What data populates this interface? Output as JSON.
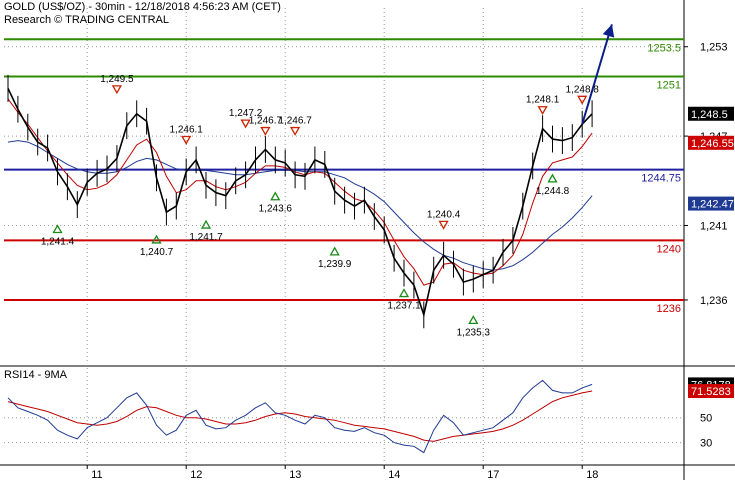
{
  "header": {
    "line1": "GOLD (US$/OZ) - 30min - 12/18/2018 4:56:23 AM (CET)",
    "line2": "Research © TRADING CENTRAL"
  },
  "colors": {
    "price": "#000000",
    "ma_fast": "#c00000",
    "ma_slow": "#1f3a93",
    "support": "#cc0000",
    "pivot": "#1f1fa0",
    "resistance": "#2e8b00",
    "arrow": "#0b1f8a",
    "grid": "#999999",
    "marker_up": "#1a8a1a",
    "marker_down": "#cc2200",
    "tag_price_bg": "#000000",
    "tag_red_bg": "#cc0000",
    "tag_blue_bg": "#1f3a93"
  },
  "chart_data": [
    {
      "type": "line",
      "title": "GOLD (US$/OZ) - 30min - 12/18/2018 4:56:23 AM (CET)",
      "ylim": [
        1231.7,
        1255.6
      ],
      "y_ticks": [
        "1,253",
        "1,247",
        "1,241",
        "1,236"
      ],
      "y_tick_values": [
        1253,
        1247,
        1241,
        1236
      ],
      "x_tick_labels": [
        "11",
        "12",
        "13",
        "14",
        "17",
        "18"
      ],
      "x_tick_index": [
        8,
        18,
        28,
        38,
        48,
        58
      ],
      "series": [
        {
          "values": [
            1250.2,
            1248.8,
            1247.6,
            1246.6,
            1246.2,
            1244.6,
            1243.6,
            1242.4,
            1243.9,
            1244.5,
            1244.8,
            1245.5,
            1247.7,
            1248.5,
            1248.0,
            1244.2,
            1241.9,
            1242.3,
            1244.6,
            1245.4,
            1243.7,
            1243.2,
            1243.0,
            1244.0,
            1244.4,
            1245.4,
            1246.1,
            1245.4,
            1245.2,
            1244.4,
            1244.3,
            1245.4,
            1245.1,
            1243.3,
            1242.7,
            1242.3,
            1242.7,
            1241.6,
            1240.7,
            1238.8,
            1237.8,
            1237.0,
            1235.0,
            1238.0,
            1239.0,
            1238.4,
            1237.2,
            1237.4,
            1237.7,
            1238.0,
            1239.2,
            1240.0,
            1242.3,
            1245.0,
            1247.5,
            1246.8,
            1246.7,
            1246.9,
            1247.8,
            1248.5
          ]
        },
        {
          "name": "",
          "values": [
            1249.5,
            1248.6,
            1247.8,
            1246.9,
            1246.0,
            1245.2,
            1244.4,
            1243.7,
            1243.4,
            1243.5,
            1243.8,
            1244.4,
            1245.4,
            1246.4,
            1246.8,
            1245.9,
            1244.3,
            1243.2,
            1243.4,
            1244.0,
            1244.0,
            1243.6,
            1243.4,
            1243.6,
            1243.9,
            1244.5,
            1245.0,
            1245.0,
            1244.9,
            1244.6,
            1244.4,
            1244.6,
            1244.5,
            1243.9,
            1243.3,
            1242.8,
            1242.6,
            1242.0,
            1241.2,
            1240.0,
            1238.9,
            1238.1,
            1237.0,
            1237.2,
            1238.4,
            1238.5,
            1238.0,
            1237.8,
            1237.7,
            1237.8,
            1238.3,
            1239.0,
            1240.4,
            1242.5,
            1244.3,
            1245.2,
            1245.4,
            1245.6,
            1246.3,
            1247.2
          ]
        },
        {
          "name": "",
          "values": [
            1246.6,
            1246.7,
            1246.6,
            1246.3,
            1245.9,
            1245.5,
            1245.1,
            1244.8,
            1244.6,
            1244.5,
            1244.5,
            1244.6,
            1244.9,
            1245.3,
            1245.5,
            1245.4,
            1245.1,
            1244.8,
            1244.7,
            1244.7,
            1244.7,
            1244.6,
            1244.5,
            1244.4,
            1244.4,
            1244.5,
            1244.6,
            1244.7,
            1244.7,
            1244.7,
            1244.6,
            1244.6,
            1244.6,
            1244.4,
            1244.2,
            1243.8,
            1243.5,
            1243.1,
            1242.6,
            1241.9,
            1241.2,
            1240.5,
            1239.9,
            1239.4,
            1239.0,
            1238.8,
            1238.5,
            1238.3,
            1238.1,
            1238.0,
            1238.1,
            1238.3,
            1238.7,
            1239.2,
            1239.8,
            1240.4,
            1240.9,
            1241.5,
            1242.2,
            1243.0
          ]
        }
      ],
      "levels": [
        {
          "value": 1253.5,
          "label": "1253.5",
          "role": "resistance"
        },
        {
          "value": 1251.0,
          "label": "1251",
          "role": "resistance"
        },
        {
          "value": 1244.75,
          "label": "1244.75",
          "role": "pivot"
        },
        {
          "value": 1240.0,
          "label": "1240",
          "role": "support"
        },
        {
          "value": 1236.0,
          "label": "1236",
          "role": "support"
        }
      ],
      "annotations": [
        {
          "label": "1,249.5",
          "i": 11,
          "value": 1249.5,
          "kind": "high"
        },
        {
          "label": "1,246.1",
          "i": 18,
          "value": 1246.1,
          "kind": "high"
        },
        {
          "label": "1,247.2",
          "i": 24,
          "value": 1247.2,
          "kind": "high"
        },
        {
          "label": "1,246.7",
          "i": 26,
          "value": 1246.7,
          "kind": "high"
        },
        {
          "label": "1,246.7",
          "i": 29,
          "value": 1246.7,
          "kind": "high"
        },
        {
          "label": "1,240.4",
          "i": 44,
          "value": 1240.4,
          "kind": "high"
        },
        {
          "label": "1,248.1",
          "i": 54,
          "value": 1248.1,
          "kind": "high"
        },
        {
          "label": "1,248.8",
          "i": 58,
          "value": 1248.8,
          "kind": "high"
        },
        {
          "label": "1,241.4",
          "i": 5,
          "value": 1241.4,
          "kind": "low"
        },
        {
          "label": "1,240.7",
          "i": 15,
          "value": 1240.7,
          "kind": "low"
        },
        {
          "label": "1,241.7",
          "i": 20,
          "value": 1241.7,
          "kind": "low"
        },
        {
          "label": "1,243.6",
          "i": 27,
          "value": 1243.6,
          "kind": "low"
        },
        {
          "label": "1,239.9",
          "i": 33,
          "value": 1239.9,
          "kind": "low"
        },
        {
          "label": "1,237.1",
          "i": 40,
          "value": 1237.1,
          "kind": "low"
        },
        {
          "label": "1,235.3",
          "i": 47,
          "value": 1235.3,
          "kind": "low"
        },
        {
          "label": "1,244.8",
          "i": 55,
          "value": 1244.8,
          "kind": "low"
        }
      ],
      "tags": [
        {
          "label": "1,248.5",
          "value": 1248.5,
          "kind": "price"
        },
        {
          "label": "1,246.55",
          "value": 1246.55,
          "kind": "red"
        },
        {
          "label": "1,242.47",
          "value": 1242.47,
          "kind": "blue"
        }
      ],
      "forecast_arrow": {
        "from": [
          58,
          1247.8
        ],
        "to": [
          61,
          1254.5
        ]
      }
    },
    {
      "type": "line",
      "title": "RSI14 - 9MA",
      "ylim": [
        12,
        90
      ],
      "y_ticks": [
        "50",
        "30"
      ],
      "y_tick_values": [
        50,
        30
      ],
      "series": [
        {
          "values": [
            66,
            58,
            55,
            52,
            48,
            40,
            36,
            33,
            42,
            46,
            50,
            58,
            66,
            70,
            60,
            44,
            36,
            40,
            52,
            56,
            44,
            41,
            42,
            48,
            52,
            58,
            62,
            54,
            52,
            48,
            45,
            52,
            50,
            42,
            40,
            39,
            42,
            38,
            36,
            30,
            28,
            27,
            22,
            40,
            52,
            46,
            36,
            38,
            40,
            42,
            48,
            54,
            66,
            74,
            80,
            72,
            70,
            70,
            74,
            76.8
          ]
        },
        {
          "values": [
            63,
            61,
            59,
            57,
            55,
            52,
            49,
            46,
            45,
            44,
            45,
            47,
            51,
            56,
            59,
            58,
            55,
            52,
            50,
            50,
            49,
            47,
            45,
            45,
            46,
            48,
            51,
            53,
            54,
            53,
            51,
            50,
            49,
            48,
            46,
            44,
            43,
            42,
            41,
            39,
            37,
            35,
            32,
            31,
            33,
            35,
            36,
            37,
            38,
            39,
            41,
            44,
            48,
            53,
            58,
            63,
            66,
            68,
            70,
            71.5
          ]
        }
      ],
      "tags": [
        {
          "label": "76.8178",
          "value": 76.8,
          "kind": "price"
        },
        {
          "label": "71.5283",
          "value": 71.5,
          "kind": "red"
        }
      ]
    }
  ]
}
